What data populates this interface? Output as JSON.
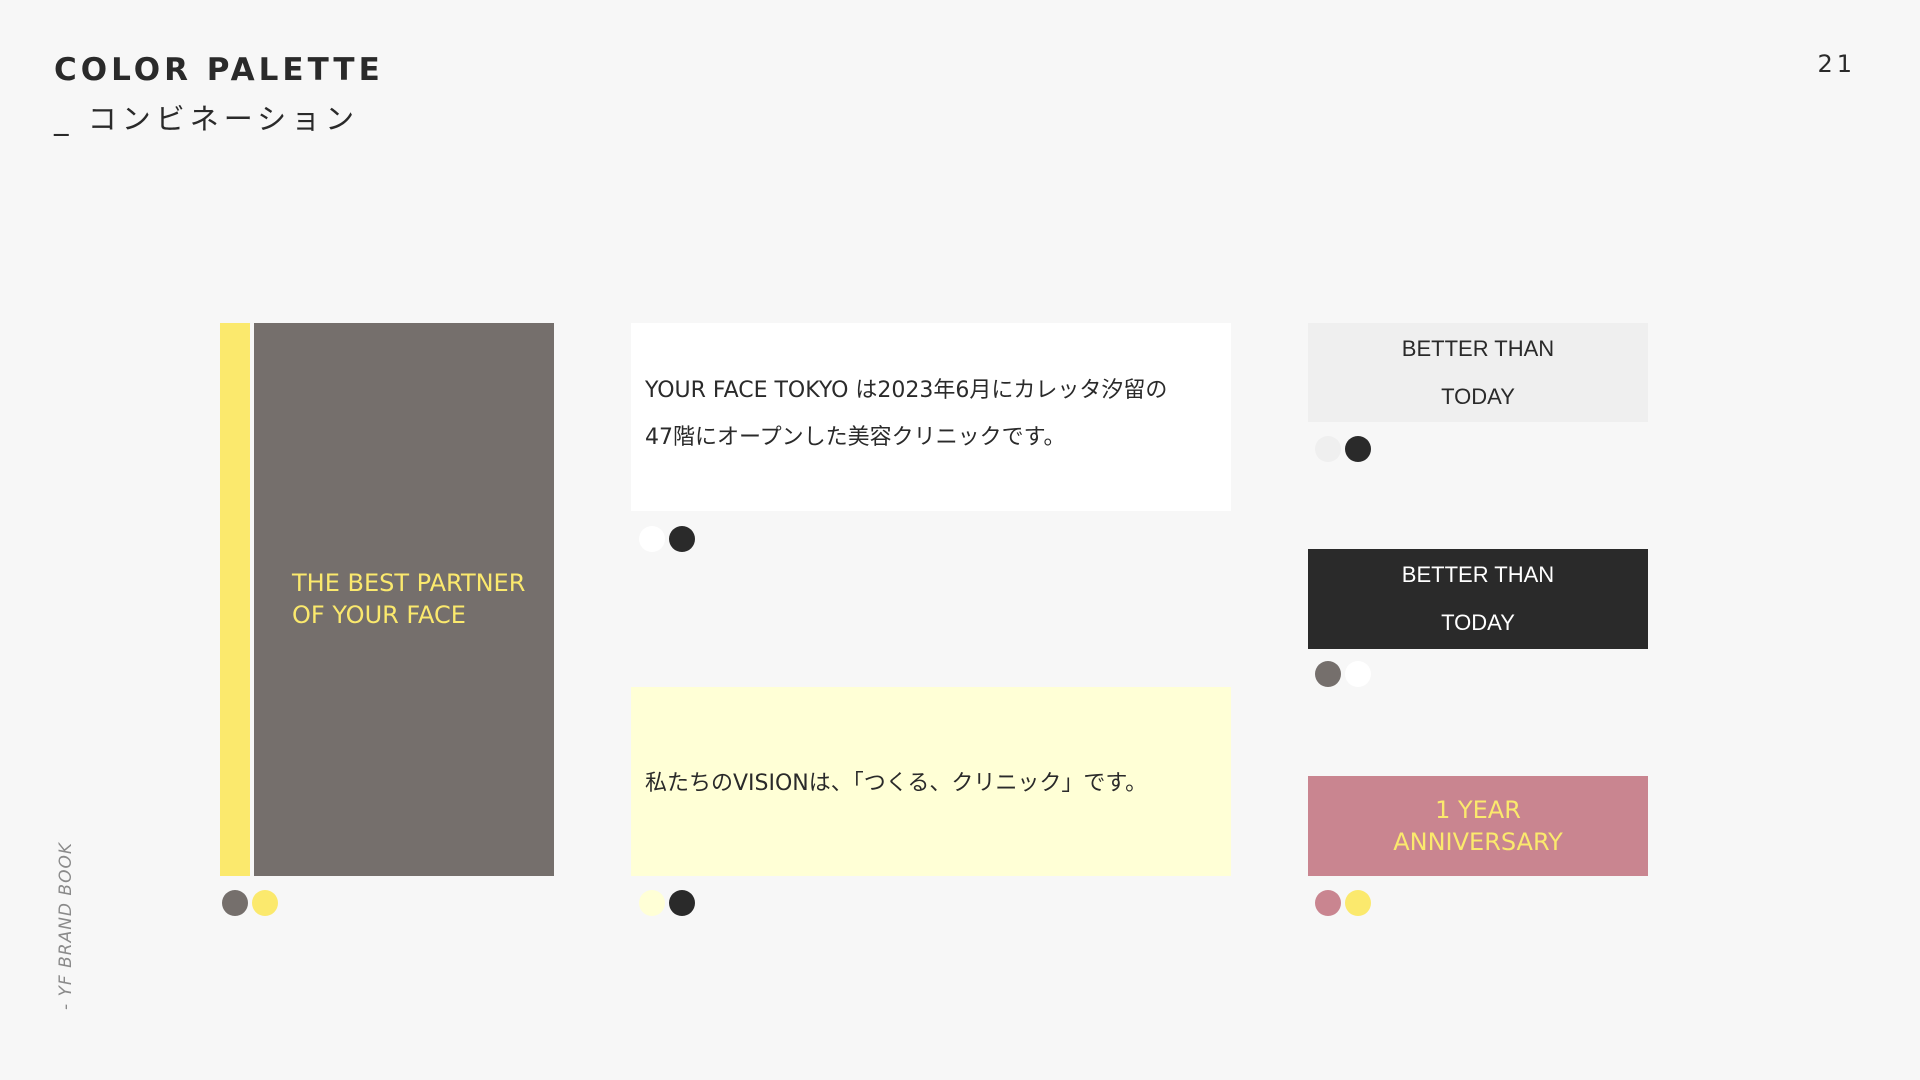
{
  "header": {
    "title": "COLOR PALETTE",
    "subtitle": "_ コンビネーション",
    "page_number": "21"
  },
  "side_label": "- YF BRAND BOOK",
  "colors": {
    "background": "#f7f7f7",
    "yellow": "#fbe96d",
    "warm_gray": "#756f6c",
    "white": "#ffffff",
    "cream": "#ffffd6",
    "light_gray": "#efefef",
    "charcoal": "#2a2a2a",
    "rose": "#c98590"
  },
  "combinations": {
    "gray_yellow": {
      "text": "THE BEST PARTNER\nOF YOUR FACE",
      "swatches": [
        "warm_gray",
        "yellow"
      ]
    },
    "white_charcoal": {
      "text": "YOUR FACE TOKYO は2023年6月にカレッタ汐留の\n47階にオープンした美容クリニックです。",
      "swatches": [
        "white",
        "charcoal"
      ]
    },
    "cream_charcoal": {
      "text": "私たちのVISIONは、「つくる、クリニック」です。",
      "swatches": [
        "cream",
        "charcoal"
      ]
    },
    "lightgray_charcoal": {
      "line1": "BETTER THAN",
      "line2": "TODAY",
      "swatches": [
        "light_gray",
        "charcoal"
      ]
    },
    "charcoal_white": {
      "line1": "BETTER THAN",
      "line2": "TODAY",
      "swatches": [
        "warm_gray",
        "white"
      ]
    },
    "rose_yellow": {
      "line1": "1 YEAR",
      "line2": "ANNIVERSARY",
      "swatches": [
        "rose",
        "yellow"
      ]
    }
  }
}
